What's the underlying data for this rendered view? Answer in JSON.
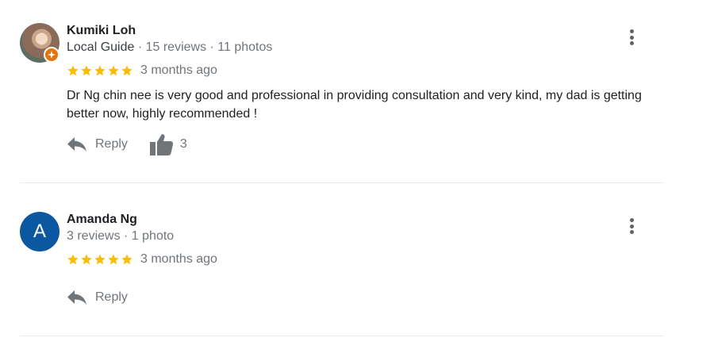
{
  "colors": {
    "star": "#fbbc04",
    "badge": "#e8710a",
    "avatar_letter_bg": "#0b57a0",
    "muted_text": "#70757a"
  },
  "reviews": [
    {
      "name": "Kumiki Loh",
      "guide_label": "Local Guide",
      "stats": " · 15 reviews · 11 photos",
      "rating": 5,
      "time": "3 months ago",
      "text": "Dr Ng chin nee is very good and professional in providing consultation and very kind, my dad is getting better now, highly recommended !",
      "reply_label": "Reply",
      "likes": "3",
      "avatar_icon": "user-photo",
      "badge_icon": "local-guide-badge-icon"
    },
    {
      "name": "Amanda Ng",
      "avatar_letter": "A",
      "stats": "3 reviews · 1 photo",
      "rating": 5,
      "time": "3 months ago",
      "reply_label": "Reply"
    }
  ]
}
